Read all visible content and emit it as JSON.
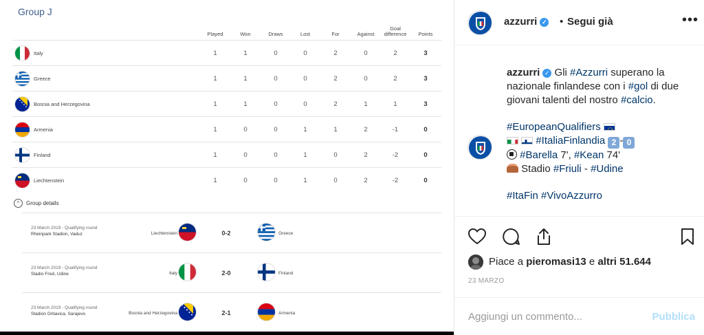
{
  "standings": {
    "group_title": "Group J",
    "headers": [
      "Played",
      "Won",
      "Draws",
      "Lost",
      "For",
      "Against",
      "Goal difference",
      "Points"
    ],
    "rows": [
      {
        "team": "Italy",
        "flag": "italy-flag-icon",
        "played": "1",
        "won": "1",
        "draws": "0",
        "lost": "0",
        "for": "2",
        "against": "0",
        "gd": "2",
        "points": "3"
      },
      {
        "team": "Greece",
        "flag": "greece-flag-icon",
        "played": "1",
        "won": "1",
        "draws": "0",
        "lost": "0",
        "for": "2",
        "against": "0",
        "gd": "2",
        "points": "3"
      },
      {
        "team": "Bosnia and Herzegovina",
        "flag": "bosnia-flag-icon",
        "played": "1",
        "won": "1",
        "draws": "0",
        "lost": "0",
        "for": "2",
        "against": "1",
        "gd": "1",
        "points": "3"
      },
      {
        "team": "Armenia",
        "flag": "armenia-flag-icon",
        "played": "1",
        "won": "0",
        "draws": "0",
        "lost": "1",
        "for": "1",
        "against": "2",
        "gd": "-1",
        "points": "0"
      },
      {
        "team": "Finland",
        "flag": "finland-flag-icon",
        "played": "1",
        "won": "0",
        "draws": "0",
        "lost": "1",
        "for": "0",
        "against": "2",
        "gd": "-2",
        "points": "0"
      },
      {
        "team": "Liechtenstein",
        "flag": "liechtenstein-flag-icon",
        "played": "1",
        "won": "0",
        "draws": "0",
        "lost": "1",
        "for": "0",
        "against": "2",
        "gd": "-2",
        "points": "0"
      }
    ],
    "details_label": "Group details",
    "matches": [
      {
        "date": "23 March 2019 - Qualifying round",
        "venue": "Rheinpark Stadion, Vaduz",
        "home": "Liechtenstein",
        "score": "0-2",
        "away": "Greece"
      },
      {
        "date": "23 March 2019 - Qualifying round",
        "venue": "Stadio Friuli, Udine",
        "home": "Italy",
        "score": "2-0",
        "away": "Finland"
      },
      {
        "date": "23 March 2019 - Qualifying round",
        "venue": "Stadion Grbavica, Sarajevo",
        "home": "Bosnia and Herzegovina",
        "score": "2-1",
        "away": "Armenia"
      }
    ]
  },
  "post": {
    "username": "azzurri",
    "dot": "•",
    "follow_label": "Segui già",
    "more_icon": "more-options-icon",
    "caption": {
      "user": "azzurri",
      "line1_a": "Gli ",
      "line1_tag": "#Azzurri",
      "line1_b": " superano la",
      "line2_a": "nazionale finlandese con i ",
      "line2_tag": "#gol",
      "line2_b": " di due",
      "line3_a": "giovani talenti del nostro ",
      "line3_tag": "#calcio",
      "line3_b": ".",
      "line4_tag": "#EuropeanQualifiers",
      "line5_tag": "#ItaliaFinlandia",
      "score_home": "2",
      "score_sep": "-",
      "score_away": "0",
      "line6_tag1": "#Barella",
      "line6_mid": " 7', ",
      "line6_tag2": "#Kean",
      "line6_end": " 74'",
      "line7_a": " Stadio ",
      "line7_tag1": "#Friuli",
      "line7_mid": " - ",
      "line7_tag2": "#Udine",
      "line8_tag1": "#ItaFin",
      "line8_tag2": "#VivoAzzurro"
    },
    "likes_prefix": "Piace a ",
    "likes_user": "pieromasi13",
    "likes_mid": " e ",
    "likes_count": "altri 51.644",
    "date": "23 MARZO",
    "comment_placeholder": "Aggiungi un commento...",
    "publish_label": "Pubblica"
  },
  "colors": {
    "hashtag": "#003569",
    "verified": "#3897f0",
    "publish_disabled": "#b2dffc",
    "group_title": "#3f5f8c"
  }
}
